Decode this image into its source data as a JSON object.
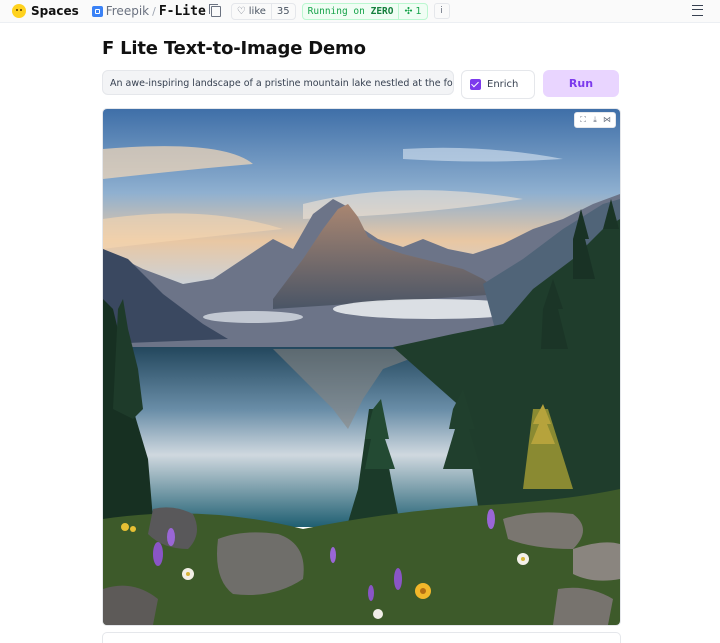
{
  "topbar": {
    "spaces_label": "Spaces",
    "owner": "Freepik",
    "repo": "F-Lite",
    "like_label": "like",
    "like_count": "35",
    "status_prefix": "Running on",
    "status_hardware": "ZERO",
    "device_count": "1",
    "info_label": "i"
  },
  "main": {
    "title": "F Lite Text-to-Image Demo",
    "prompt_value": "An awe-inspiring landscape of a pristine mountain lake nestled at the foot of a t",
    "enrich_label": "Enrich",
    "enrich_checked": true,
    "run_label": "Run"
  },
  "image": {
    "alt": "generated mountain lake landscape"
  },
  "colors": {
    "accent": "#7c3aed",
    "run_bg": "#e9d5ff",
    "status_green": "#16a34a"
  },
  "icons": [
    "huggingface-logo-icon",
    "owner-badge-icon",
    "copy-icon",
    "heart-icon",
    "chip-icon",
    "info-icon",
    "menu-icon",
    "fullscreen-icon",
    "download-icon",
    "share-icon"
  ]
}
